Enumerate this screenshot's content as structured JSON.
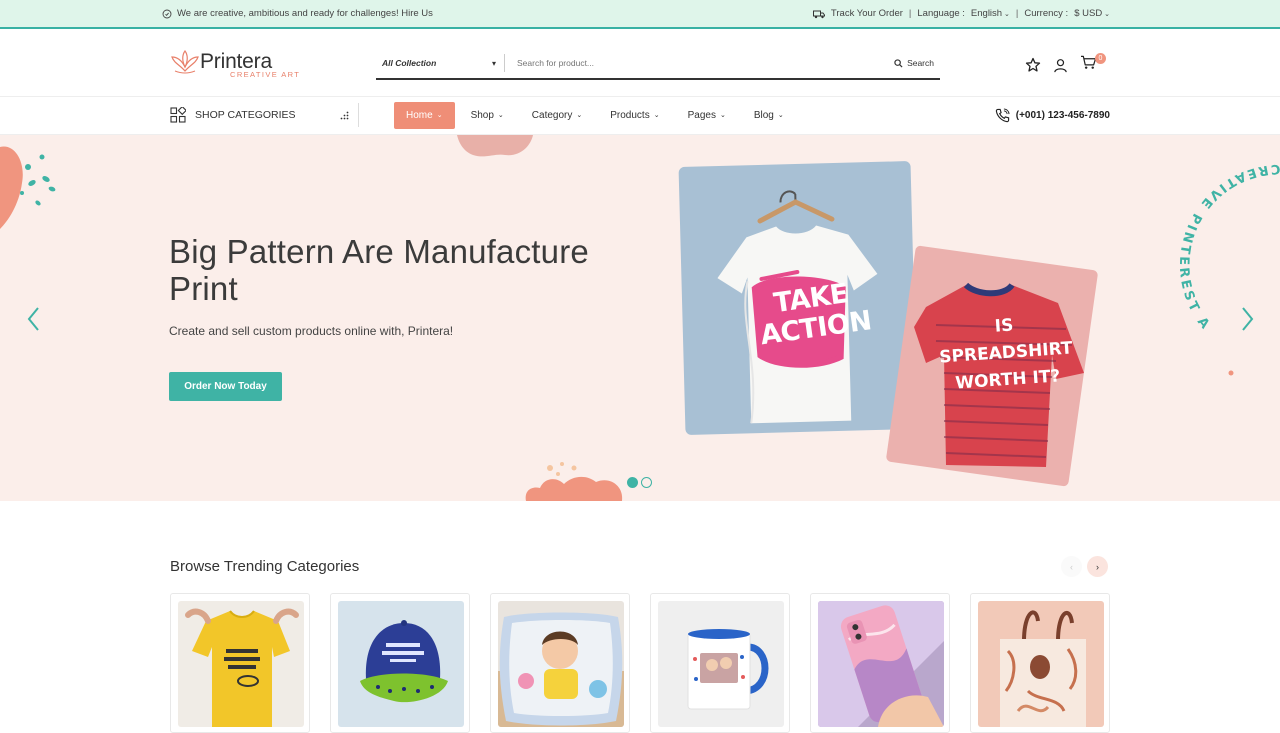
{
  "topbar": {
    "message": "We are creative, ambitious and ready for challenges! Hire Us",
    "track": "Track Your Order",
    "language_label": "Language :",
    "language_value": "English",
    "currency_label": "Currency :",
    "currency_value": "$ USD"
  },
  "header": {
    "logo_name": "Printera",
    "logo_tag": "CREATIVE ART",
    "collection": "All Collection",
    "search_placeholder": "Search for product...",
    "search_button": "Search",
    "cart_count": "0"
  },
  "nav": {
    "shop_categories": "SHOP CATEGORIES",
    "items": [
      {
        "label": "Home"
      },
      {
        "label": "Shop"
      },
      {
        "label": "Category"
      },
      {
        "label": "Products"
      },
      {
        "label": "Pages"
      },
      {
        "label": "Blog"
      }
    ],
    "phone": "(+001) 123-456-7890"
  },
  "hero": {
    "title": "Big Pattern Are Manufacture Print",
    "subtitle": "Create and sell custom products online with, Printera!",
    "cta": "Order Now Today",
    "shirt1_text": "TAKE ACTION",
    "shirt2_line1": "IS",
    "shirt2_line2": "SPREADSHIRT",
    "shirt2_line3": "WORTH IT?",
    "circle_text": "CREATIVE PINTEREST A",
    "slide_count": 2,
    "active_slide": 1
  },
  "trending": {
    "title": "Browse Trending Categories"
  },
  "colors": {
    "accent": "#3fb3a5",
    "brand": "#ef8e77",
    "topbar_bg": "#dff5ea",
    "hero_bg": "#fbeeea"
  }
}
